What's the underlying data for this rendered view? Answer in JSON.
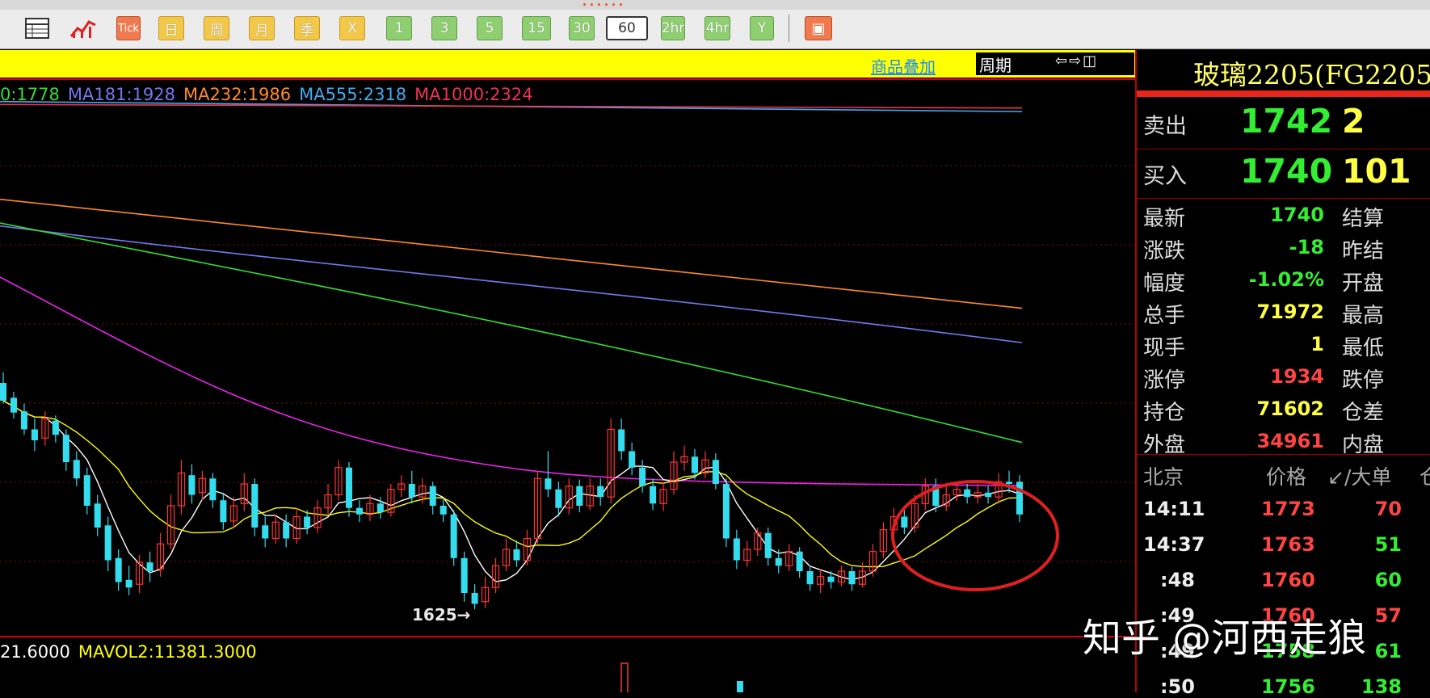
{
  "toolbar": {
    "buttons": [
      {
        "label": "Tick",
        "style": "r"
      },
      {
        "label": "日",
        "style": "y"
      },
      {
        "label": "周",
        "style": "y"
      },
      {
        "label": "月",
        "style": "y"
      },
      {
        "label": "季",
        "style": "y"
      },
      {
        "label": "X",
        "style": "y"
      },
      {
        "label": "1",
        "style": "g"
      },
      {
        "label": "3",
        "style": "g"
      },
      {
        "label": "5",
        "style": "g"
      },
      {
        "label": "15",
        "style": "g"
      },
      {
        "label": "30",
        "style": "g"
      },
      {
        "label": "60",
        "style": "sel"
      },
      {
        "label": "2hr",
        "style": "g"
      },
      {
        "label": "4hr",
        "style": "g"
      },
      {
        "label": "Y",
        "style": "g"
      }
    ]
  },
  "chart_header": {
    "overlay_link": "商品叠加",
    "period_label": "周期",
    "nav_arrows": "⇦⇨◫"
  },
  "legend": [
    {
      "text": "0:1778",
      "color": "#33dd33"
    },
    {
      "text": "MA181:1928",
      "color": "#7777ee"
    },
    {
      "text": "MA232:1986",
      "color": "#ff8a2a"
    },
    {
      "text": "MA555:2318",
      "color": "#44aaee"
    },
    {
      "text": "MA1000:2324",
      "color": "#ee3355"
    }
  ],
  "volume_legend": [
    {
      "text": "21.6000",
      "color": "#ffffff"
    },
    {
      "text": "MAVOL2:11381.3000",
      "color": "#ffff00"
    }
  ],
  "chart_data": {
    "type": "candlestick",
    "ylim": [
      1600,
      2400
    ],
    "low_annotation": "1625→",
    "low_value": 1625,
    "ma_lines": [
      {
        "name": "MA555",
        "color": "#44aaee",
        "start": 2335,
        "end": 2318
      },
      {
        "name": "MA1000",
        "color": "#ee3355",
        "start": 2330,
        "end": 2324
      },
      {
        "name": "MA232",
        "color": "#ff8a2a",
        "start": 2170,
        "end": 1986
      },
      {
        "name": "MA181",
        "color": "#7777ee",
        "start": 2125,
        "end": 1928
      },
      {
        "name": "green",
        "color": "#33dd33",
        "start": 2130,
        "end": 1778
      }
    ],
    "candles": [
      [
        1860,
        1830,
        1878,
        1825
      ],
      [
        1835,
        1810,
        1845,
        1800
      ],
      [
        1812,
        1790,
        1825,
        1785
      ],
      [
        1790,
        1780,
        1800,
        1770
      ],
      [
        1782,
        1800,
        1812,
        1775
      ],
      [
        1798,
        1785,
        1805,
        1778
      ],
      [
        1785,
        1760,
        1790,
        1752
      ],
      [
        1762,
        1745,
        1770,
        1738
      ],
      [
        1748,
        1720,
        1755,
        1712
      ],
      [
        1722,
        1700,
        1730,
        1692
      ],
      [
        1702,
        1670,
        1710,
        1660
      ],
      [
        1672,
        1650,
        1680,
        1642
      ],
      [
        1652,
        1645,
        1665,
        1638
      ],
      [
        1648,
        1668,
        1675,
        1640
      ],
      [
        1668,
        1660,
        1678,
        1650
      ],
      [
        1662,
        1685,
        1695,
        1655
      ],
      [
        1685,
        1720,
        1730,
        1680
      ],
      [
        1720,
        1750,
        1762,
        1712
      ],
      [
        1748,
        1730,
        1758,
        1722
      ],
      [
        1732,
        1745,
        1752,
        1725
      ],
      [
        1745,
        1725,
        1750,
        1718
      ],
      [
        1725,
        1705,
        1732,
        1698
      ],
      [
        1706,
        1720,
        1728,
        1700
      ],
      [
        1722,
        1740,
        1750,
        1715
      ],
      [
        1740,
        1700,
        1745,
        1692
      ],
      [
        1702,
        1690,
        1710,
        1682
      ],
      [
        1690,
        1705,
        1712,
        1685
      ],
      [
        1705,
        1690,
        1712,
        1682
      ],
      [
        1690,
        1710,
        1718,
        1685
      ],
      [
        1710,
        1700,
        1716,
        1694
      ],
      [
        1700,
        1718,
        1725,
        1695
      ],
      [
        1718,
        1730,
        1740,
        1712
      ],
      [
        1730,
        1755,
        1762,
        1725
      ],
      [
        1755,
        1718,
        1760,
        1710
      ],
      [
        1718,
        1712,
        1725,
        1705
      ],
      [
        1712,
        1722,
        1730,
        1706
      ],
      [
        1722,
        1714,
        1728,
        1708
      ],
      [
        1714,
        1735,
        1740,
        1710
      ],
      [
        1735,
        1740,
        1748,
        1728
      ],
      [
        1740,
        1728,
        1752,
        1722
      ],
      [
        1728,
        1738,
        1745,
        1722
      ],
      [
        1738,
        1720,
        1742,
        1712
      ],
      [
        1720,
        1712,
        1726,
        1705
      ],
      [
        1712,
        1672,
        1716,
        1665
      ],
      [
        1672,
        1640,
        1678,
        1632
      ],
      [
        1640,
        1630,
        1648,
        1625
      ],
      [
        1632,
        1645,
        1655,
        1626
      ],
      [
        1645,
        1665,
        1672,
        1640
      ],
      [
        1665,
        1680,
        1690,
        1660
      ],
      [
        1680,
        1670,
        1688,
        1664
      ],
      [
        1670,
        1690,
        1698,
        1665
      ],
      [
        1690,
        1745,
        1752,
        1685
      ],
      [
        1745,
        1735,
        1770,
        1728
      ],
      [
        1735,
        1718,
        1742,
        1710
      ],
      [
        1718,
        1738,
        1745,
        1712
      ],
      [
        1738,
        1720,
        1744,
        1714
      ],
      [
        1720,
        1738,
        1745,
        1716
      ],
      [
        1738,
        1728,
        1745,
        1720
      ],
      [
        1728,
        1790,
        1800,
        1722
      ],
      [
        1790,
        1770,
        1800,
        1762
      ],
      [
        1770,
        1755,
        1778,
        1748
      ],
      [
        1755,
        1738,
        1762,
        1732
      ],
      [
        1738,
        1722,
        1745,
        1716
      ],
      [
        1722,
        1735,
        1742,
        1715
      ],
      [
        1735,
        1760,
        1770,
        1730
      ],
      [
        1760,
        1765,
        1775,
        1752
      ],
      [
        1765,
        1750,
        1772,
        1744
      ],
      [
        1750,
        1762,
        1770,
        1745
      ],
      [
        1762,
        1740,
        1768,
        1735
      ],
      [
        1740,
        1690,
        1745,
        1682
      ],
      [
        1690,
        1670,
        1698,
        1662
      ],
      [
        1670,
        1680,
        1688,
        1664
      ],
      [
        1680,
        1695,
        1700,
        1674
      ],
      [
        1695,
        1672,
        1700,
        1665
      ],
      [
        1672,
        1665,
        1680,
        1658
      ],
      [
        1665,
        1678,
        1685,
        1660
      ],
      [
        1678,
        1660,
        1682,
        1654
      ],
      [
        1660,
        1648,
        1665,
        1642
      ],
      [
        1648,
        1655,
        1662,
        1640
      ],
      [
        1655,
        1650,
        1660,
        1644
      ],
      [
        1650,
        1660,
        1665,
        1646
      ],
      [
        1660,
        1648,
        1664,
        1642
      ],
      [
        1648,
        1660,
        1668,
        1645
      ],
      [
        1660,
        1678,
        1685,
        1655
      ],
      [
        1678,
        1698,
        1705,
        1672
      ],
      [
        1698,
        1710,
        1718,
        1692
      ],
      [
        1710,
        1700,
        1716,
        1694
      ],
      [
        1700,
        1722,
        1730,
        1695
      ],
      [
        1722,
        1738,
        1745,
        1716
      ],
      [
        1738,
        1720,
        1745,
        1714
      ],
      [
        1720,
        1730,
        1738,
        1715
      ],
      [
        1730,
        1735,
        1742,
        1724
      ],
      [
        1735,
        1728,
        1740,
        1722
      ],
      [
        1728,
        1732,
        1740,
        1722
      ],
      [
        1732,
        1728,
        1738,
        1722
      ],
      [
        1728,
        1742,
        1750,
        1722
      ],
      [
        1742,
        1740,
        1752,
        1732
      ],
      [
        1742,
        1712,
        1748,
        1705
      ]
    ]
  },
  "quote": {
    "title": "玻璃2205(FG2205",
    "sell_label": "卖出",
    "sell_price": "1742",
    "sell_qty": "2",
    "buy_label": "买入",
    "buy_price": "1740",
    "buy_qty": "101",
    "rows": [
      {
        "label": "最新",
        "value": "1740",
        "color": "#33ee33",
        "label2": "结算"
      },
      {
        "label": "涨跌",
        "value": "-18",
        "color": "#33ee33",
        "label2": "昨结"
      },
      {
        "label": "幅度",
        "value": "-1.02%",
        "color": "#33ee33",
        "label2": "开盘"
      },
      {
        "label": "总手",
        "value": "71972",
        "color": "#ffff44",
        "label2": "最高"
      },
      {
        "label": "现手",
        "value": "1",
        "color": "#ffff44",
        "label2": "最低"
      },
      {
        "label": "涨停",
        "value": "1934",
        "color": "#ff4444",
        "label2": "跌停"
      },
      {
        "label": "持仓",
        "value": "71602",
        "color": "#ffff44",
        "label2": "仓差"
      },
      {
        "label": "外盘",
        "value": "34961",
        "color": "#ff4444",
        "label2": "内盘"
      }
    ],
    "ticks_header": {
      "c1": "北京",
      "c2": "价格",
      "c3": "↙/大单",
      "c4": "仓"
    },
    "ticks": [
      {
        "time": "14:11",
        "price": "1773",
        "vol": "70",
        "pcolor": "#ff4444",
        "vcolor": "#ff4444"
      },
      {
        "time": "14:37",
        "price": "1763",
        "vol": "51",
        "pcolor": "#ff4444",
        "vcolor": "#33ee33"
      },
      {
        "time": ":48",
        "price": "1760",
        "vol": "60",
        "pcolor": "#ff4444",
        "vcolor": "#33ee33"
      },
      {
        "time": ":49",
        "price": "1760",
        "vol": "57",
        "pcolor": "#ff4444",
        "vcolor": "#ff4444"
      },
      {
        "time": ":49",
        "price": "1758",
        "vol": "61",
        "pcolor": "#33ee33",
        "vcolor": "#33ee33"
      },
      {
        "time": ":50",
        "price": "1756",
        "vol": "138",
        "pcolor": "#33ee33",
        "vcolor": "#33ee33"
      }
    ]
  },
  "watermark": "知乎 @河西走狼"
}
